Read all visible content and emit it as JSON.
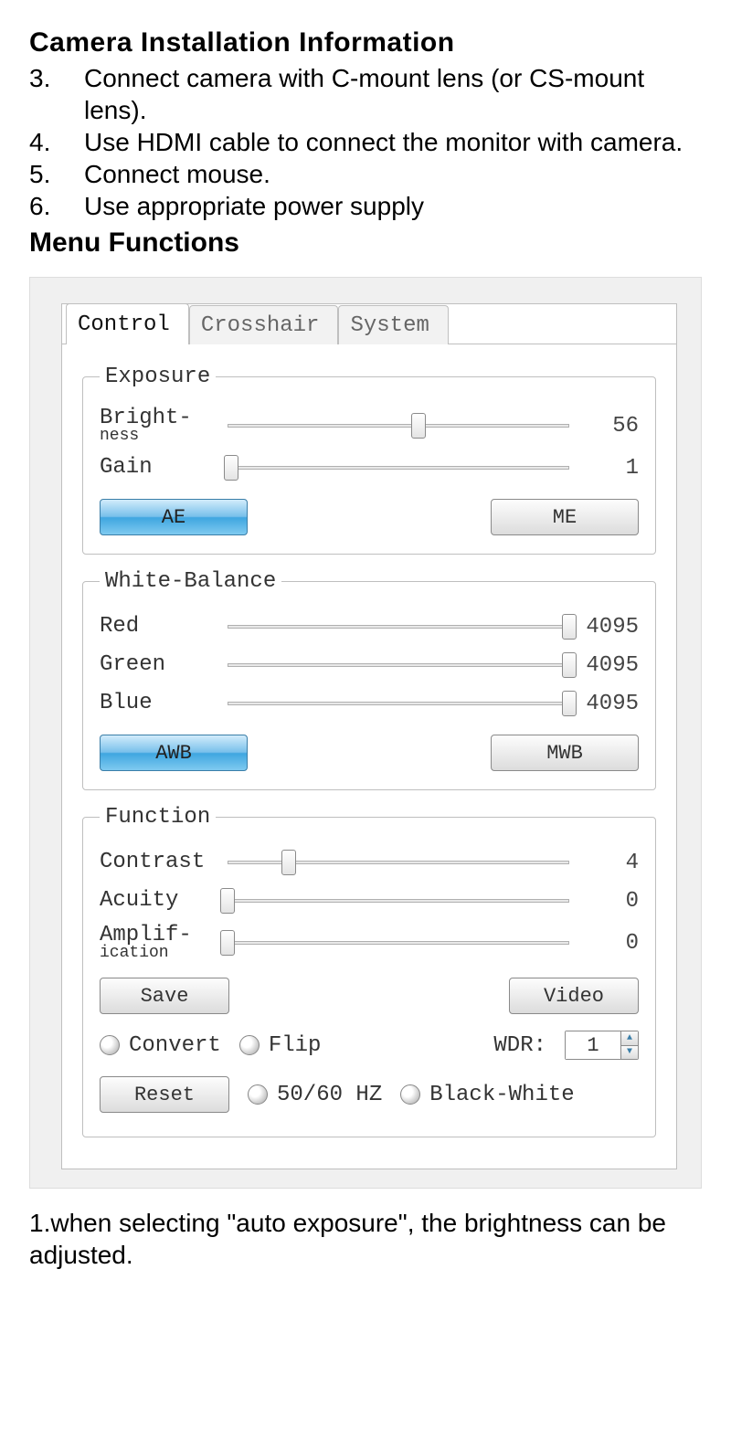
{
  "heading": "Camera Installation Information",
  "steps": [
    {
      "num": "3.",
      "text": "Connect   camera with C-mount lens (or CS-mount lens)."
    },
    {
      "num": "4.",
      "text": "Use HDMI cable to connect the monitor with camera."
    },
    {
      "num": "5.",
      "text": "Connect mouse."
    },
    {
      "num": "6.",
      "text": "Use appropriate power supply"
    }
  ],
  "heading2": "Menu Functions",
  "tabs": {
    "control": "Control",
    "crosshair": "Crosshair",
    "system": "System"
  },
  "exposure": {
    "legend": "Exposure",
    "brightness": {
      "label1": "Bright-",
      "label2": "ness",
      "value": "56",
      "pos_pct": 56
    },
    "gain": {
      "label": "Gain",
      "value": "1",
      "pos_pct": 1
    },
    "ae": "AE",
    "me": "ME"
  },
  "wb": {
    "legend": "White-Balance",
    "red": {
      "label": "Red",
      "value": "4095",
      "pos_pct": 100
    },
    "green": {
      "label": "Green",
      "value": "4095",
      "pos_pct": 100
    },
    "blue": {
      "label": "Blue",
      "value": "4095",
      "pos_pct": 100
    },
    "awb": "AWB",
    "mwb": "MWB"
  },
  "func": {
    "legend": "Function",
    "contrast": {
      "label": "Contrast",
      "value": "4",
      "pos_pct": 18
    },
    "acuity": {
      "label": "Acuity",
      "value": "0",
      "pos_pct": 0
    },
    "amp": {
      "label1": "Amplif-",
      "label2": "ication",
      "value": "0",
      "pos_pct": 0
    },
    "save": "Save",
    "video": "Video",
    "convert": "Convert",
    "flip": "Flip",
    "wdr_label": "WDR:",
    "wdr_value": "1",
    "reset": "Reset",
    "hz": "50/60 HZ",
    "bw": "Black-White"
  },
  "footnote": "1.when selecting \"auto exposure\", the brightness can be adjusted."
}
